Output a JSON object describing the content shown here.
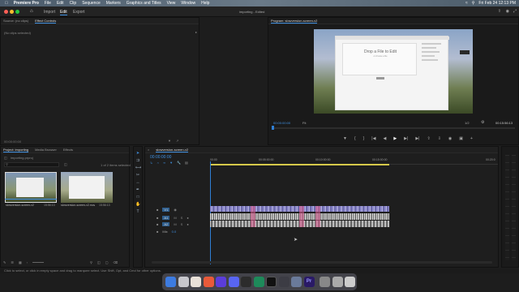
{
  "menubar": {
    "app_name": "Premiere Pro",
    "items": [
      "File",
      "Edit",
      "Clip",
      "Sequence",
      "Markers",
      "Graphics and Titles",
      "View",
      "Window",
      "Help"
    ],
    "clock": "Fri Feb 24  12:13 PM"
  },
  "appbar": {
    "tabs": [
      "Import",
      "Edit",
      "Export"
    ],
    "active_tab": "Edit",
    "title": "importing - Edited"
  },
  "source_panel": {
    "tabs": [
      "Source: (no clips)",
      "Effect Controls"
    ],
    "message": "(No clips selected)",
    "timecode": "00:00:00:00"
  },
  "program_panel": {
    "title": "Program: slowversion-screen-v2",
    "timecode_left": "00:00:00:00",
    "fit": "Fit",
    "ratio": "1/2",
    "timecode_right": "00:15:56:13",
    "preview": {
      "heading": "Drop a File to Edit",
      "subtext": "or choose a file"
    }
  },
  "project_panel": {
    "tabs": [
      "Project: importing",
      "Media Browser",
      "Effects"
    ],
    "project_file": "importing.prproj",
    "selection_info": "1 of 2 items selected",
    "clips": [
      {
        "name": "slowversion-screen-v2",
        "duration": "15:56:13"
      },
      {
        "name": "slowversion-screen-v2.mov",
        "duration": "15:56:13"
      }
    ]
  },
  "timeline": {
    "tab": "slowversion-screen-v2",
    "timecode": "00:00:00:00",
    "ruler": [
      "00:00",
      "00:05:00:00",
      "00:10:00:00",
      "00:15:00:00",
      "00:20:0"
    ],
    "tracks": {
      "video": [
        "V3",
        "V2",
        "V1"
      ],
      "audio": [
        "A1",
        "A2",
        "A3"
      ],
      "mix": "Mix",
      "mix_value": "0.0"
    }
  },
  "statusbar": {
    "text": "Click to select, or click in empty space and drag to marquee select. Use Shift, Opt, and Cmd for other options."
  },
  "colors": {
    "accent": "#3f8fe0",
    "video_clip": "#8a87c9",
    "audio_clip": "#3a8a6a",
    "playhead": "#2f7fd4",
    "work_area": "#d6c94a"
  }
}
